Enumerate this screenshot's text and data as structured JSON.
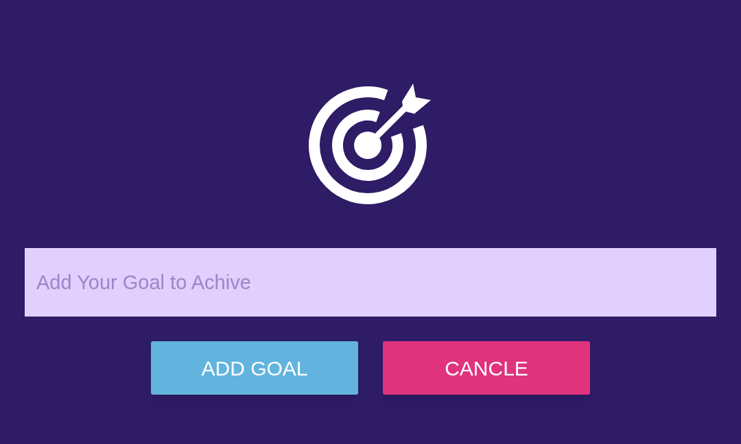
{
  "goal_field": {
    "placeholder": "Add Your Goal to Achive"
  },
  "buttons": [
    {
      "label": "ADD GOAL",
      "kind": "primary"
    },
    {
      "label": "CANCLE",
      "kind": "danger"
    }
  ]
}
